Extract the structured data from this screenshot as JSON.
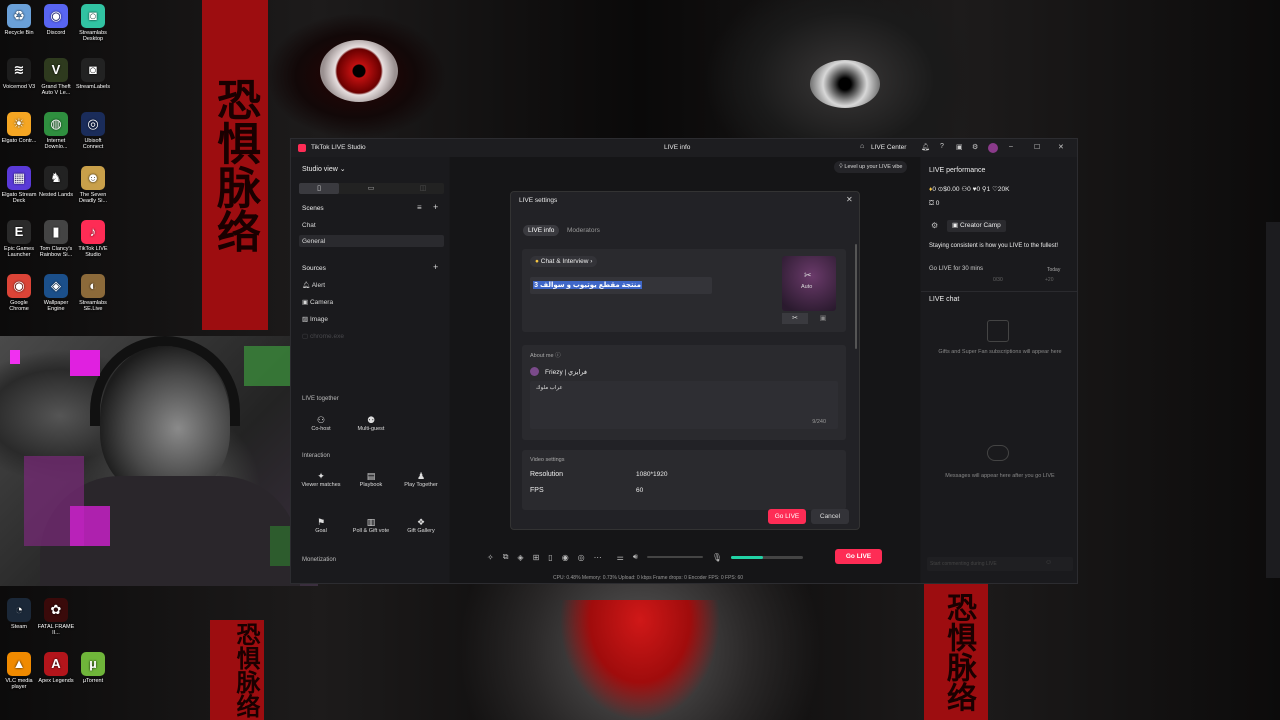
{
  "desktop": {
    "icons": [
      {
        "label": "Recycle Bin",
        "icon": "recycle-bin-icon",
        "color": "#6aa0d8",
        "glyph": "♻"
      },
      {
        "label": "Discord",
        "icon": "discord-icon",
        "color": "#5865f2",
        "glyph": "◉"
      },
      {
        "label": "Streamlabs Desktop",
        "icon": "streamlabs-icon",
        "color": "#31c3a2",
        "glyph": "◙"
      },
      {
        "label": "Voicemod V3",
        "icon": "voicemod-icon",
        "color": "#1d1d1d",
        "glyph": "≋"
      },
      {
        "label": "Grand Theft Auto V Le...",
        "icon": "gta-icon",
        "color": "#2e3a1e",
        "glyph": "V"
      },
      {
        "label": "StreamLabels",
        "icon": "streamlabels-icon",
        "color": "#222",
        "glyph": "◙"
      },
      {
        "label": "Elgato Contr...",
        "icon": "elgato-control-icon",
        "color": "#f5a623",
        "glyph": "☀"
      },
      {
        "label": "Internet Downlo...",
        "icon": "idm-icon",
        "color": "#2f8f3f",
        "glyph": "◍"
      },
      {
        "label": "Ubisoft Connect",
        "icon": "ubisoft-icon",
        "color": "#1a2c5a",
        "glyph": "◎"
      },
      {
        "label": "Elgato Stream Deck",
        "icon": "stream-deck-icon",
        "color": "#5a3ad8",
        "glyph": "▦"
      },
      {
        "label": "Nested Lands",
        "icon": "nested-lands-icon",
        "color": "#222",
        "glyph": "♞"
      },
      {
        "label": "The Seven Deadly Si...",
        "icon": "seven-deadly-icon",
        "color": "#c9a04a",
        "glyph": "☻"
      },
      {
        "label": "Epic Games Launcher",
        "icon": "epic-games-icon",
        "color": "#2a2a2a",
        "glyph": "E"
      },
      {
        "label": "Tom Clancy's Rainbow Si...",
        "icon": "rainbow-six-icon",
        "color": "#444",
        "glyph": "▮"
      },
      {
        "label": "TikTok LIVE Studio",
        "icon": "tiktok-live-studio-icon",
        "color": "#fe2c55",
        "glyph": "♪"
      },
      {
        "label": "Google Chrome",
        "icon": "chrome-icon",
        "color": "#db4437",
        "glyph": "◉"
      },
      {
        "label": "Wallpaper Engine",
        "icon": "wallpaper-engine-icon",
        "color": "#1b4f8a",
        "glyph": "◈"
      },
      {
        "label": "Streamlabs SE.Live",
        "icon": "se-live-icon",
        "color": "#8c6a3a",
        "glyph": "◐"
      },
      {
        "label": "Steam",
        "icon": "steam-icon",
        "color": "#1b2838",
        "glyph": "◔"
      },
      {
        "label": "FATAL FRAME II...",
        "icon": "fatal-frame-icon",
        "color": "#3a0a0a",
        "glyph": "✿"
      },
      {
        "label": "VLC media player",
        "icon": "vlc-icon",
        "color": "#f08a00",
        "glyph": "▲"
      },
      {
        "label": "Apex Legends",
        "icon": "apex-icon",
        "color": "#b3151b",
        "glyph": "A"
      },
      {
        "label": "µTorrent",
        "icon": "utorrent-icon",
        "color": "#6fb53a",
        "glyph": "µ"
      }
    ],
    "banner_text": "恐惧脉络"
  },
  "app": {
    "title": "TikTok LIVE Studio",
    "center_title": "LIVE info",
    "live_center": "LIVE Center",
    "studio_view": "Studio view",
    "level_up": "Level up your LIVE vibe",
    "scenes_header": "Scenes",
    "scenes": [
      "Chat",
      "General"
    ],
    "sources_header": "Sources",
    "sources": [
      "Alert",
      "Camera",
      "Image",
      "chrome.exe"
    ],
    "live_together": "LIVE together",
    "live_together_items": [
      "Co-host",
      "Multi-guest"
    ],
    "interaction": "Interaction",
    "interaction_items": [
      "Viewer matches",
      "Playbook",
      "Play Together",
      "Goal",
      "Poll & Gift vote",
      "Gift Gallery"
    ],
    "monetization": "Monetization",
    "go_live": "Go LIVE",
    "stats": "CPU: 0.48%      Memory: 0.73%      Upload: 0 kbps      Frame drops: 0      Encoder FPS: 0      FPS: 60"
  },
  "modal": {
    "title": "LIVE settings",
    "tabs": [
      "LIVE info",
      "Moderators"
    ],
    "topic": "Chat & Interview",
    "title_value": "منتجة مقطع يوتيوب و سوالف 3",
    "cover_label": "Auto",
    "about_label": "About me",
    "profile_name": "Friezy | فرايزي",
    "about_text": "عراب ملوك",
    "about_count": "9/240",
    "video_header": "Video settings",
    "resolution_label": "Resolution",
    "resolution_value": "1080*1920",
    "fps_label": "FPS",
    "fps_value": "60",
    "go_live": "Go LIVE",
    "cancel": "Cancel"
  },
  "right": {
    "perf_title": "LIVE performance",
    "stats": [
      "0",
      "$0.00",
      "0",
      "0",
      "1",
      "20K"
    ],
    "stat_row2": "0",
    "creator_camp": "Creator Camp",
    "camp_text": "Staying consistent is how you LIVE to the fullest!",
    "camp_goal": "Go LIVE for 30 mins",
    "camp_progress": "0/30",
    "camp_today": "Today",
    "camp_bonus": "+20",
    "chat_title": "LIVE chat",
    "gifts_text": "Gifts and Super Fan subscriptions will appear here",
    "messages_text": "Messages will appear here after you go LIVE",
    "chat_placeholder": "Start commenting during LIVE"
  },
  "colors": {
    "accent": "#fe2c55",
    "mic_level": "#22d3a6"
  },
  "mic_level": 0.45
}
